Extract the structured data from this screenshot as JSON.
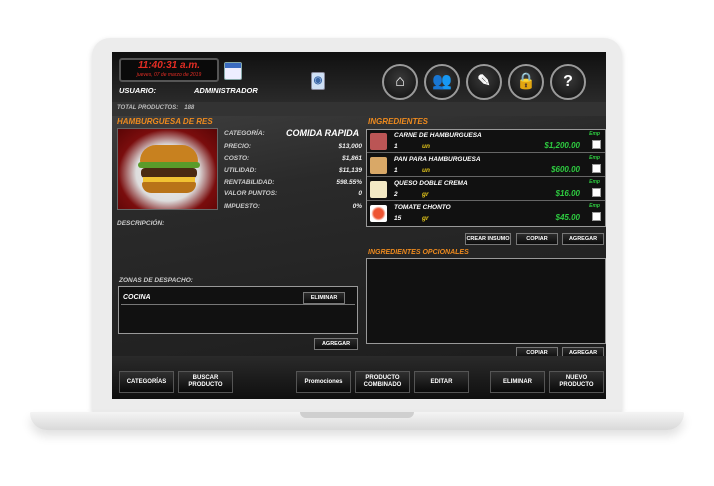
{
  "header": {
    "time": "11:40:31 a.m.",
    "date": "jueves, 07 de marzo de 2019",
    "user_label": "USUARIO:",
    "user_value": "ADMINISTRADOR",
    "nav_icons": [
      "home-icon",
      "users-icon",
      "edit-icon",
      "lock-icon",
      "help-icon"
    ],
    "help_glyph": "?"
  },
  "info": {
    "total_label": "TOTAL PRODUCTOS:",
    "total_value": "188"
  },
  "product": {
    "name": "HAMBURGUESA DE RES",
    "fields": [
      {
        "label": "CATEGORÍA:",
        "value": "COMIDA RAPIDA"
      },
      {
        "label": "PRECIO:",
        "value": "$13,000"
      },
      {
        "label": "COSTO:",
        "value": "$1,861"
      },
      {
        "label": "UTILIDAD:",
        "value": "$11,139"
      },
      {
        "label": "RENTABILIDAD:",
        "value": "598.55%"
      },
      {
        "label": "VALOR PUNTOS:",
        "value": "0"
      },
      {
        "label": "IMPUESTO:",
        "value": "0%"
      }
    ],
    "description_label": "DESCRIPCIÓN:"
  },
  "zonas": {
    "label": "ZONAS DE DESPACHO:",
    "items": [
      {
        "name": "COCINA",
        "delete_label": "ELIMINAR"
      }
    ],
    "add_label": "AGREGAR"
  },
  "ingredients": {
    "title": "INGREDIENTES",
    "items": [
      {
        "name": "CARNE DE HAMBURGUESA",
        "qty": "1",
        "unit": "un",
        "price": "$1,200.00",
        "emp": "Emp"
      },
      {
        "name": "PAN PARA HAMBURGUESA",
        "qty": "1",
        "unit": "un",
        "price": "$600.00",
        "emp": "Emp"
      },
      {
        "name": "QUESO DOBLE CREMA",
        "qty": "2",
        "unit": "gr",
        "price": "$16.00",
        "emp": "Emp"
      },
      {
        "name": "TOMATE CHONTO",
        "qty": "15",
        "unit": "gr",
        "price": "$45.00",
        "emp": "Emp"
      }
    ],
    "buttons": {
      "crear": "CREAR INSUMO",
      "copiar": "COPIAR",
      "agregar": "AGREGAR"
    }
  },
  "optional": {
    "title": "INGREDIENTES OPCIONALES",
    "buttons": {
      "copiar": "COPIAR",
      "agregar": "AGREGAR"
    }
  },
  "bottom": {
    "categorias": "CATEGORÍAS",
    "buscar": "BUSCAR PRODUCTO",
    "promociones": "Promociones",
    "combinado": "PRODUCTO COMBINADO",
    "editar": "EDITAR",
    "eliminar": "ELIMINAR",
    "nuevo": "NUEVO PRODUCTO"
  },
  "colors": {
    "accent": "#ee8a1e",
    "price": "#2ecc40",
    "unit": "#e6c81a",
    "clock": "#e42d24"
  }
}
